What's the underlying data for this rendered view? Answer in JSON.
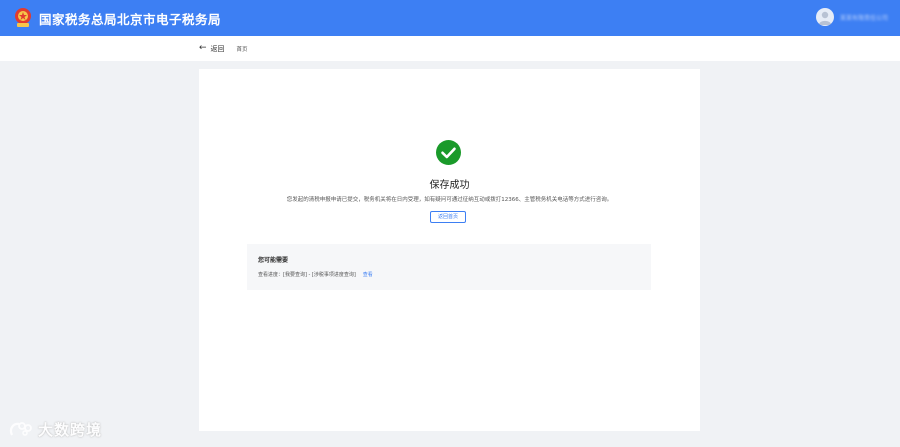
{
  "header": {
    "site_title": "国家税务总局北京市电子税务局",
    "user_name": "某某有限责任公司"
  },
  "nav": {
    "back_label": "返回",
    "breadcrumb": "首页"
  },
  "result": {
    "title": "保存成功",
    "description": "您发起的清税申报申请已提交，税务机关将在日内受理，如有疑问可通过征纳互动或拨打12366、主管税务机关电话等方式进行咨询。",
    "home_button_label": "返回首页"
  },
  "needs": {
    "title": "您可能需要",
    "view_progress_prefix": "查看进度：[我要查询] - [涉税事项进度查询]",
    "view_link": "查看"
  },
  "watermark": {
    "text": "大数跨境"
  },
  "colors": {
    "header_blue": "#3d7ff3",
    "success_green": "#1a9a2a",
    "page_bg": "#f0f2f5"
  }
}
